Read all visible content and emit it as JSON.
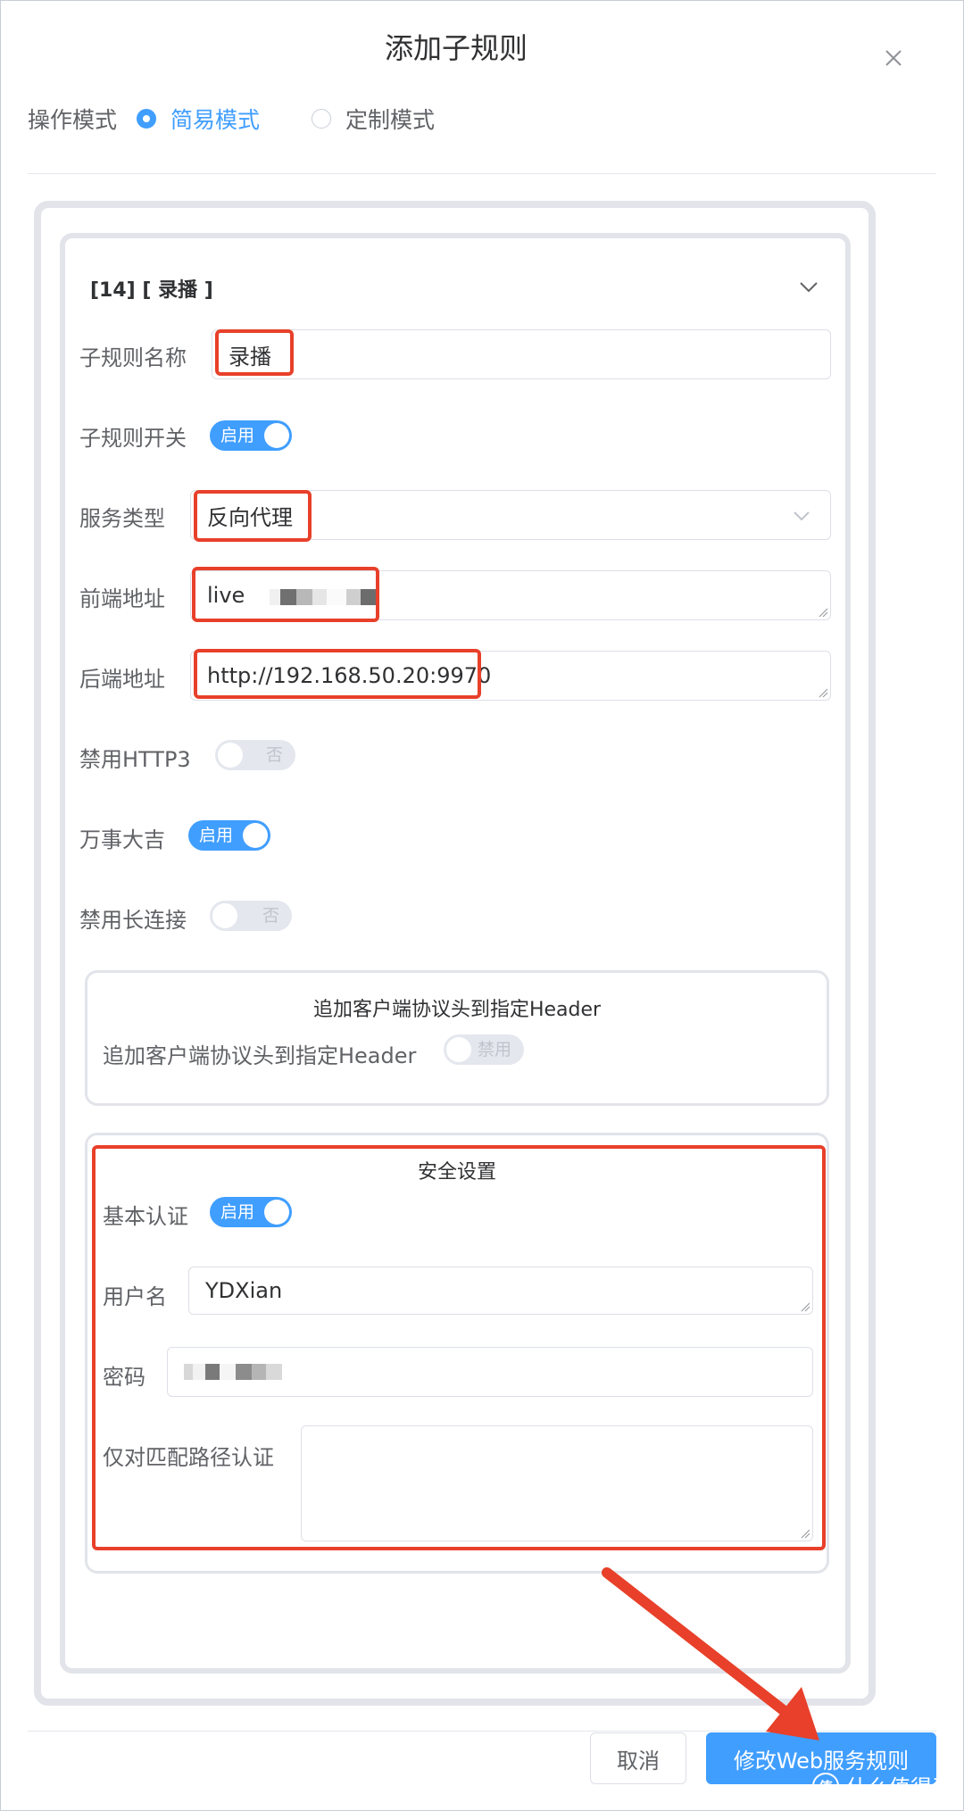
{
  "dialog": {
    "title": "添加子规则",
    "close_icon": "close-icon"
  },
  "mode": {
    "label": "操作模式",
    "options": [
      {
        "label": "简易模式",
        "selected": true
      },
      {
        "label": "定制模式",
        "selected": false
      }
    ]
  },
  "rule": {
    "header": "[14] [ 录播 ]",
    "name_label": "子规则名称",
    "name_value": "录播",
    "switch_label": "子规则开关",
    "switch_text": "启用",
    "switch_on": true,
    "service_label": "服务类型",
    "service_value": "反向代理",
    "frontend_label": "前端地址",
    "frontend_value": "live",
    "backend_label": "后端地址",
    "backend_value": "http://192.168.50.20:9970",
    "http3_label": "禁用HTTP3",
    "http3_text": "否",
    "http3_on": false,
    "wanshi_label": "万事大吉",
    "wanshi_text": "启用",
    "wanshi_on": true,
    "keepalive_label": "禁用长连接",
    "keepalive_text": "否",
    "keepalive_on": false
  },
  "header_section": {
    "title": "追加客户端协议头到指定Header",
    "label": "追加客户端协议头到指定Header",
    "switch_text": "禁用",
    "switch_on": false
  },
  "security": {
    "title": "安全设置",
    "auth_label": "基本认证",
    "auth_text": "启用",
    "auth_on": true,
    "user_label": "用户名",
    "user_value": "YDXian",
    "password_label": "密码",
    "password_value": "",
    "path_label": "仅对匹配路径认证",
    "path_value": ""
  },
  "footer": {
    "cancel_label": "取消",
    "submit_label": "修改Web服务规则"
  },
  "watermark": {
    "badge": "值",
    "text": "什么值得买"
  },
  "colors": {
    "primary": "#409eff",
    "highlight": "#e8402a",
    "card_border": "#e2e4ea"
  }
}
